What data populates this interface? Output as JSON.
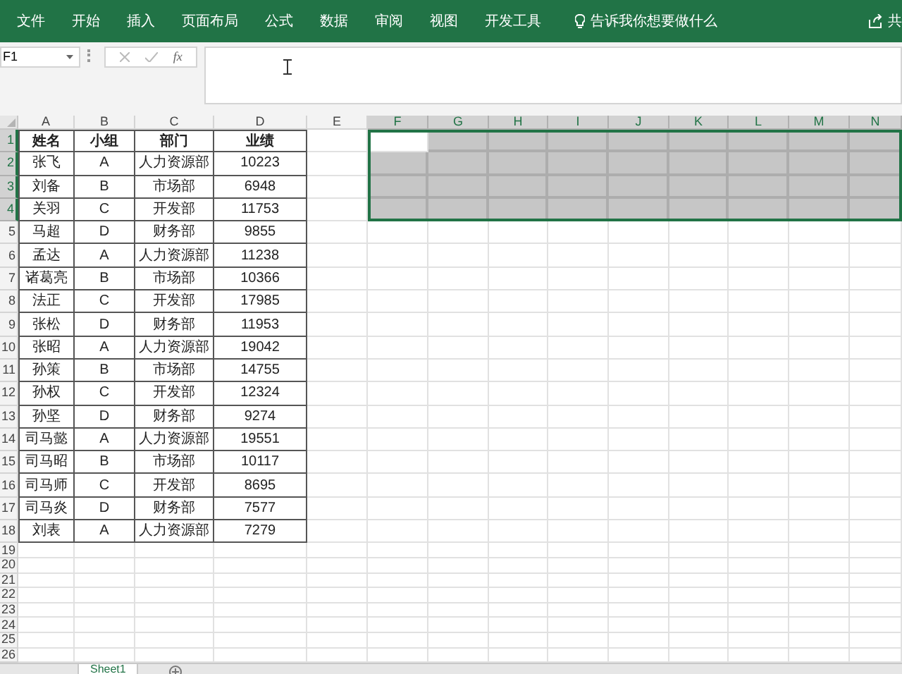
{
  "ribbon": {
    "tabs": [
      {
        "label": "文件"
      },
      {
        "label": "开始"
      },
      {
        "label": "插入"
      },
      {
        "label": "页面布局"
      },
      {
        "label": "公式"
      },
      {
        "label": "数据"
      },
      {
        "label": "审阅"
      },
      {
        "label": "视图"
      },
      {
        "label": "开发工具"
      }
    ],
    "tell_me": "告诉我你想要做什么",
    "share": "共"
  },
  "name_box": "F1",
  "formula_bar": {
    "function_button": "fx"
  },
  "columns": [
    {
      "label": "A",
      "selected": false
    },
    {
      "label": "B",
      "selected": false
    },
    {
      "label": "C",
      "selected": false
    },
    {
      "label": "D",
      "selected": false
    },
    {
      "label": "E",
      "selected": false
    },
    {
      "label": "F",
      "selected": true
    },
    {
      "label": "G",
      "selected": true
    },
    {
      "label": "H",
      "selected": true
    },
    {
      "label": "I",
      "selected": true
    },
    {
      "label": "J",
      "selected": true
    },
    {
      "label": "K",
      "selected": true
    },
    {
      "label": "L",
      "selected": true
    },
    {
      "label": "M",
      "selected": true
    },
    {
      "label": "N",
      "selected": true
    }
  ],
  "rows": [
    {
      "number": "1",
      "selected": true,
      "cells": [
        "姓名",
        "小组",
        "部门",
        "业绩"
      ]
    },
    {
      "number": "2",
      "selected": true,
      "cells": [
        "张飞",
        "A",
        "人力资源部",
        "10223"
      ]
    },
    {
      "number": "3",
      "selected": true,
      "cells": [
        "刘备",
        "B",
        "市场部",
        "6948"
      ]
    },
    {
      "number": "4",
      "selected": true,
      "cells": [
        "关羽",
        "C",
        "开发部",
        "11753"
      ]
    },
    {
      "number": "5",
      "selected": false,
      "cells": [
        "马超",
        "D",
        "财务部",
        "9855"
      ]
    },
    {
      "number": "6",
      "selected": false,
      "cells": [
        "孟达",
        "A",
        "人力资源部",
        "11238"
      ]
    },
    {
      "number": "7",
      "selected": false,
      "cells": [
        "诸葛亮",
        "B",
        "市场部",
        "10366"
      ]
    },
    {
      "number": "8",
      "selected": false,
      "cells": [
        "法正",
        "C",
        "开发部",
        "17985"
      ]
    },
    {
      "number": "9",
      "selected": false,
      "cells": [
        "张松",
        "D",
        "财务部",
        "11953"
      ]
    },
    {
      "number": "10",
      "selected": false,
      "cells": [
        "张昭",
        "A",
        "人力资源部",
        "19042"
      ]
    },
    {
      "number": "11",
      "selected": false,
      "cells": [
        "孙策",
        "B",
        "市场部",
        "14755"
      ]
    },
    {
      "number": "12",
      "selected": false,
      "cells": [
        "孙权",
        "C",
        "开发部",
        "12324"
      ]
    },
    {
      "number": "13",
      "selected": false,
      "cells": [
        "孙坚",
        "D",
        "财务部",
        "9274"
      ]
    },
    {
      "number": "14",
      "selected": false,
      "cells": [
        "司马懿",
        "A",
        "人力资源部",
        "19551"
      ]
    },
    {
      "number": "15",
      "selected": false,
      "cells": [
        "司马昭",
        "B",
        "市场部",
        "10117"
      ]
    },
    {
      "number": "16",
      "selected": false,
      "cells": [
        "司马师",
        "C",
        "开发部",
        "8695"
      ]
    },
    {
      "number": "17",
      "selected": false,
      "cells": [
        "司马炎",
        "D",
        "财务部",
        "7577"
      ]
    },
    {
      "number": "18",
      "selected": false,
      "cells": [
        "刘表",
        "A",
        "人力资源部",
        "7279"
      ]
    },
    {
      "number": "19",
      "selected": false,
      "cells": []
    },
    {
      "number": "20",
      "selected": false,
      "cells": []
    },
    {
      "number": "21",
      "selected": false,
      "cells": []
    },
    {
      "number": "22",
      "selected": false,
      "cells": []
    },
    {
      "number": "23",
      "selected": false,
      "cells": []
    },
    {
      "number": "24",
      "selected": false,
      "cells": []
    },
    {
      "number": "25",
      "selected": false,
      "cells": []
    },
    {
      "number": "26",
      "selected": false,
      "cells": []
    }
  ],
  "sheet_tabs": [
    {
      "label": "Sheet1",
      "selected": true
    }
  ]
}
